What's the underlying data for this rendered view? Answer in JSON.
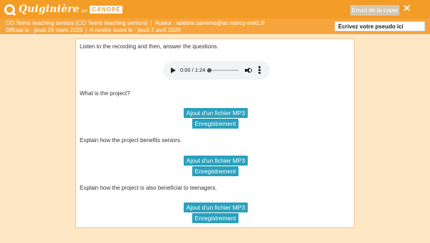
{
  "header": {
    "logo_name": "Quiginière",
    "logo_par": "par",
    "logo_canope": "CANOPÉ",
    "send_button": "Envoi de la copie",
    "close": "✕"
  },
  "info": {
    "title": "CO Teens teaching seniors (CO Teens teaching seniors)",
    "author": "Auteur : adeline.saverna@ac-nancy-metz.fr",
    "published": "Diffusé le : jeudi 26 mars 2020",
    "due": "A rendre avant le : jeudi 2 avril 2020",
    "separator": "|",
    "pseudo_placeholder": "Écrivez votre pseudo ici"
  },
  "content": {
    "intro": "Listen to the recording and then, answer the questions.",
    "audio": {
      "time": "0:00 / 1:24",
      "progress": 0
    },
    "questions": [
      {
        "text": "What is the project?",
        "mp3_label": "Ajout d'un fichier MP3",
        "record_label": "Enregistrement"
      },
      {
        "text": "Explain how the project benefits seniors.",
        "mp3_label": "Ajout d'un fichier MP3",
        "record_label": "Enregistrement"
      },
      {
        "text": "Explain how the project is also beneficial to teenagers.",
        "mp3_label": "Ajout d'un fichier MP3",
        "record_label": "Enregistrement"
      }
    ]
  },
  "colors": {
    "topbar": "#f39c26",
    "infobar": "#f6a43b",
    "background": "#fde7c5",
    "button": "#2aa1bd"
  }
}
